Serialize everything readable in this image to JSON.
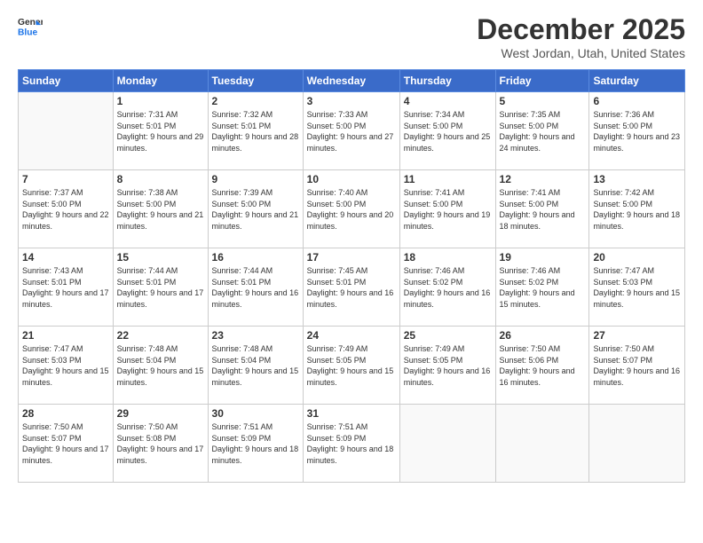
{
  "logo": {
    "line1": "General",
    "line2": "Blue"
  },
  "title": "December 2025",
  "location": "West Jordan, Utah, United States",
  "days_of_week": [
    "Sunday",
    "Monday",
    "Tuesday",
    "Wednesday",
    "Thursday",
    "Friday",
    "Saturday"
  ],
  "weeks": [
    [
      {
        "day": "",
        "sunrise": "",
        "sunset": "",
        "daylight": ""
      },
      {
        "day": "1",
        "sunrise": "Sunrise: 7:31 AM",
        "sunset": "Sunset: 5:01 PM",
        "daylight": "Daylight: 9 hours and 29 minutes."
      },
      {
        "day": "2",
        "sunrise": "Sunrise: 7:32 AM",
        "sunset": "Sunset: 5:01 PM",
        "daylight": "Daylight: 9 hours and 28 minutes."
      },
      {
        "day": "3",
        "sunrise": "Sunrise: 7:33 AM",
        "sunset": "Sunset: 5:00 PM",
        "daylight": "Daylight: 9 hours and 27 minutes."
      },
      {
        "day": "4",
        "sunrise": "Sunrise: 7:34 AM",
        "sunset": "Sunset: 5:00 PM",
        "daylight": "Daylight: 9 hours and 25 minutes."
      },
      {
        "day": "5",
        "sunrise": "Sunrise: 7:35 AM",
        "sunset": "Sunset: 5:00 PM",
        "daylight": "Daylight: 9 hours and 24 minutes."
      },
      {
        "day": "6",
        "sunrise": "Sunrise: 7:36 AM",
        "sunset": "Sunset: 5:00 PM",
        "daylight": "Daylight: 9 hours and 23 minutes."
      }
    ],
    [
      {
        "day": "7",
        "sunrise": "Sunrise: 7:37 AM",
        "sunset": "Sunset: 5:00 PM",
        "daylight": "Daylight: 9 hours and 22 minutes."
      },
      {
        "day": "8",
        "sunrise": "Sunrise: 7:38 AM",
        "sunset": "Sunset: 5:00 PM",
        "daylight": "Daylight: 9 hours and 21 minutes."
      },
      {
        "day": "9",
        "sunrise": "Sunrise: 7:39 AM",
        "sunset": "Sunset: 5:00 PM",
        "daylight": "Daylight: 9 hours and 21 minutes."
      },
      {
        "day": "10",
        "sunrise": "Sunrise: 7:40 AM",
        "sunset": "Sunset: 5:00 PM",
        "daylight": "Daylight: 9 hours and 20 minutes."
      },
      {
        "day": "11",
        "sunrise": "Sunrise: 7:41 AM",
        "sunset": "Sunset: 5:00 PM",
        "daylight": "Daylight: 9 hours and 19 minutes."
      },
      {
        "day": "12",
        "sunrise": "Sunrise: 7:41 AM",
        "sunset": "Sunset: 5:00 PM",
        "daylight": "Daylight: 9 hours and 18 minutes."
      },
      {
        "day": "13",
        "sunrise": "Sunrise: 7:42 AM",
        "sunset": "Sunset: 5:00 PM",
        "daylight": "Daylight: 9 hours and 18 minutes."
      }
    ],
    [
      {
        "day": "14",
        "sunrise": "Sunrise: 7:43 AM",
        "sunset": "Sunset: 5:01 PM",
        "daylight": "Daylight: 9 hours and 17 minutes."
      },
      {
        "day": "15",
        "sunrise": "Sunrise: 7:44 AM",
        "sunset": "Sunset: 5:01 PM",
        "daylight": "Daylight: 9 hours and 17 minutes."
      },
      {
        "day": "16",
        "sunrise": "Sunrise: 7:44 AM",
        "sunset": "Sunset: 5:01 PM",
        "daylight": "Daylight: 9 hours and 16 minutes."
      },
      {
        "day": "17",
        "sunrise": "Sunrise: 7:45 AM",
        "sunset": "Sunset: 5:01 PM",
        "daylight": "Daylight: 9 hours and 16 minutes."
      },
      {
        "day": "18",
        "sunrise": "Sunrise: 7:46 AM",
        "sunset": "Sunset: 5:02 PM",
        "daylight": "Daylight: 9 hours and 16 minutes."
      },
      {
        "day": "19",
        "sunrise": "Sunrise: 7:46 AM",
        "sunset": "Sunset: 5:02 PM",
        "daylight": "Daylight: 9 hours and 15 minutes."
      },
      {
        "day": "20",
        "sunrise": "Sunrise: 7:47 AM",
        "sunset": "Sunset: 5:03 PM",
        "daylight": "Daylight: 9 hours and 15 minutes."
      }
    ],
    [
      {
        "day": "21",
        "sunrise": "Sunrise: 7:47 AM",
        "sunset": "Sunset: 5:03 PM",
        "daylight": "Daylight: 9 hours and 15 minutes."
      },
      {
        "day": "22",
        "sunrise": "Sunrise: 7:48 AM",
        "sunset": "Sunset: 5:04 PM",
        "daylight": "Daylight: 9 hours and 15 minutes."
      },
      {
        "day": "23",
        "sunrise": "Sunrise: 7:48 AM",
        "sunset": "Sunset: 5:04 PM",
        "daylight": "Daylight: 9 hours and 15 minutes."
      },
      {
        "day": "24",
        "sunrise": "Sunrise: 7:49 AM",
        "sunset": "Sunset: 5:05 PM",
        "daylight": "Daylight: 9 hours and 15 minutes."
      },
      {
        "day": "25",
        "sunrise": "Sunrise: 7:49 AM",
        "sunset": "Sunset: 5:05 PM",
        "daylight": "Daylight: 9 hours and 16 minutes."
      },
      {
        "day": "26",
        "sunrise": "Sunrise: 7:50 AM",
        "sunset": "Sunset: 5:06 PM",
        "daylight": "Daylight: 9 hours and 16 minutes."
      },
      {
        "day": "27",
        "sunrise": "Sunrise: 7:50 AM",
        "sunset": "Sunset: 5:07 PM",
        "daylight": "Daylight: 9 hours and 16 minutes."
      }
    ],
    [
      {
        "day": "28",
        "sunrise": "Sunrise: 7:50 AM",
        "sunset": "Sunset: 5:07 PM",
        "daylight": "Daylight: 9 hours and 17 minutes."
      },
      {
        "day": "29",
        "sunrise": "Sunrise: 7:50 AM",
        "sunset": "Sunset: 5:08 PM",
        "daylight": "Daylight: 9 hours and 17 minutes."
      },
      {
        "day": "30",
        "sunrise": "Sunrise: 7:51 AM",
        "sunset": "Sunset: 5:09 PM",
        "daylight": "Daylight: 9 hours and 18 minutes."
      },
      {
        "day": "31",
        "sunrise": "Sunrise: 7:51 AM",
        "sunset": "Sunset: 5:09 PM",
        "daylight": "Daylight: 9 hours and 18 minutes."
      },
      {
        "day": "",
        "sunrise": "",
        "sunset": "",
        "daylight": ""
      },
      {
        "day": "",
        "sunrise": "",
        "sunset": "",
        "daylight": ""
      },
      {
        "day": "",
        "sunrise": "",
        "sunset": "",
        "daylight": ""
      }
    ]
  ]
}
